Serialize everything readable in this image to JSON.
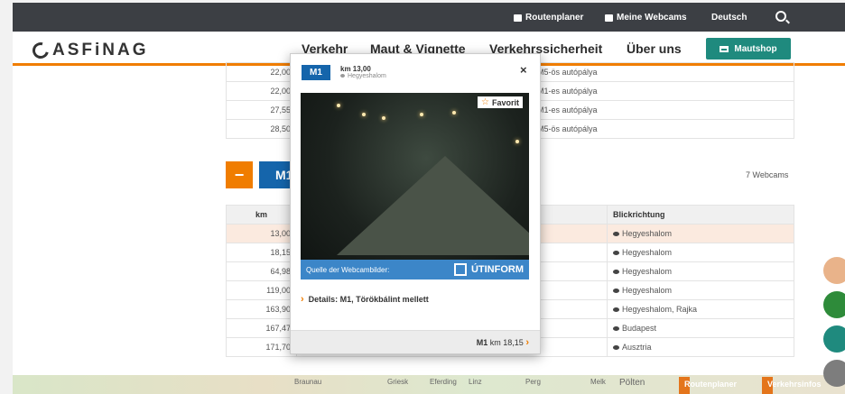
{
  "topbar": {
    "routenplaner": "Routenplaner",
    "webcams": "Meine Webcams",
    "language": "Deutsch"
  },
  "header": {
    "logo": "ASFiNAG",
    "nav": [
      "Verkehr",
      "Maut & Vignette",
      "Verkehrssicherheit",
      "Über uns"
    ],
    "shop_label": "Mautshop"
  },
  "upper_table": {
    "rows": [
      {
        "km": "22,00",
        "dir": "M5-ös autópálya"
      },
      {
        "km": "22,00",
        "dir": "M1-es autópálya"
      },
      {
        "km": "27,55",
        "dir": "M1-es autópálya"
      },
      {
        "km": "28,50",
        "dir": "M5-ös autópálya"
      }
    ]
  },
  "section": {
    "minus": "−",
    "road": "M1",
    "count": "7 Webcams"
  },
  "lower_table": {
    "headers": {
      "km": "km",
      "dir": "Blickrichtung"
    },
    "rows": [
      {
        "km": "13,00",
        "dir": "Hegyeshalom"
      },
      {
        "km": "18,15",
        "dir": "Hegyeshalom"
      },
      {
        "km": "64,98",
        "dir": "Hegyeshalom"
      },
      {
        "km": "119,00",
        "dir": "Hegyeshalom"
      },
      {
        "km": "163,90",
        "dir": "Hegyeshalom, Rajka"
      },
      {
        "km": "167,47",
        "dir": "Budapest"
      },
      {
        "km": "171,70",
        "dir": "Ausztria"
      }
    ]
  },
  "popup": {
    "road": "M1",
    "km": "km 13,00",
    "direction": "Hegyeshalom",
    "close": "×",
    "favorite": "Favorit",
    "source_label": "Quelle der Webcambilder:",
    "source_name": "ÚTINFORM",
    "details": "Details: M1, Törökbálint mellett",
    "next_road": "M1",
    "next_km": "km 18,15"
  },
  "map": {
    "places": [
      "Braunau",
      "Griesk",
      "Eferding",
      "Linz",
      "Perg",
      "Melk",
      "Pölten"
    ],
    "btn_route": "Routenplaner",
    "btn_info": "Verkehrsinfos"
  },
  "fab_colors": [
    "#e9b38a",
    "#2e8b3a",
    "#1f8a7e",
    "#7d7d7d"
  ]
}
